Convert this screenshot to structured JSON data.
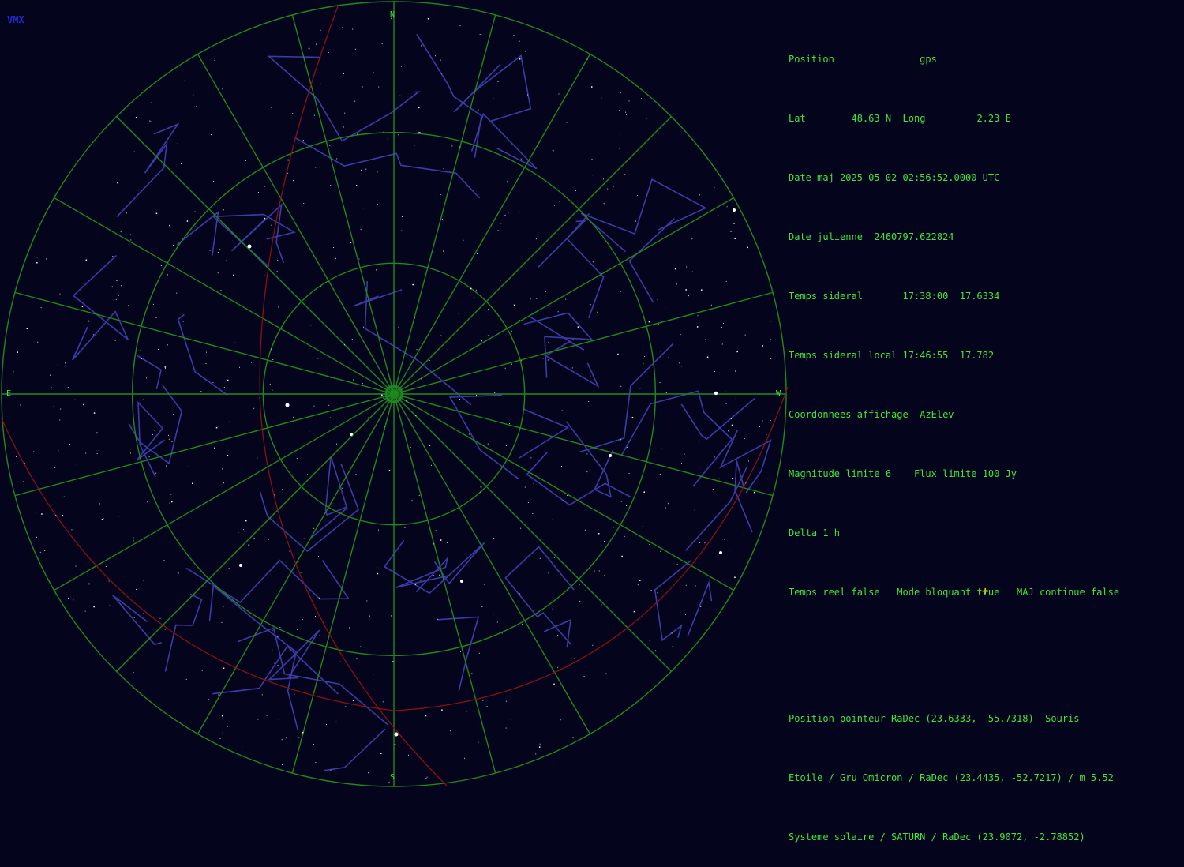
{
  "app": {
    "logo": "VMX"
  },
  "sky": {
    "cardinals": {
      "north": "N",
      "south": "S",
      "east": "E",
      "west": "W"
    },
    "colors": {
      "background": "#04041c",
      "grid": "#1e8a1e",
      "ecliptic": "#8b1010",
      "constellation": "#3c3ca8",
      "star": "#ffffff",
      "text": "#3ee63e",
      "cursor": "#ffb000"
    },
    "grid": {
      "altitude_circles_deg": [
        0,
        30,
        60
      ],
      "azimuth_step_deg": 15
    }
  },
  "info": {
    "position_label": "Position",
    "position_value": "gps",
    "lat_label": "Lat",
    "lat_value": "48.63 N",
    "long_label": "Long",
    "long_value": "2.23 E",
    "date_label": "Date maj",
    "date_value": "2025-05-02 02:56:52.0000 UTC",
    "julian_label": "Date julienne",
    "julian_value": "2460797.622824",
    "sidereal_label": "Temps sideral",
    "sidereal_value": "17:38:00  17.6334",
    "local_sidereal_label": "Temps sideral local",
    "local_sidereal_value": "17:46:55  17.782",
    "coords_label": "Coordonnees affichage",
    "coords_value": "AzElev",
    "mag_label": "Magnitude limite",
    "mag_value": "6",
    "flux_label": "Flux limite",
    "flux_value": "100 Jy",
    "delta_label": "Delta",
    "delta_value": "1 h",
    "realtime_label": "Temps reel",
    "realtime_value": "false",
    "blocking_label": "Mode bloquant",
    "blocking_value": "true",
    "continuous_label": "MAJ continue",
    "continuous_value": "false",
    "pointer_label": "Position pointeur RaDec",
    "pointer_value": "(23.6333, -55.7318)",
    "pointer_source": "Souris",
    "star_line": "Etoile / Gru_Omicron / RaDec (23.4435, -52.7217) / m 5.52",
    "solar_line": "Systeme solaire / SATURN / RaDec (23.9072, -2.78852)"
  }
}
